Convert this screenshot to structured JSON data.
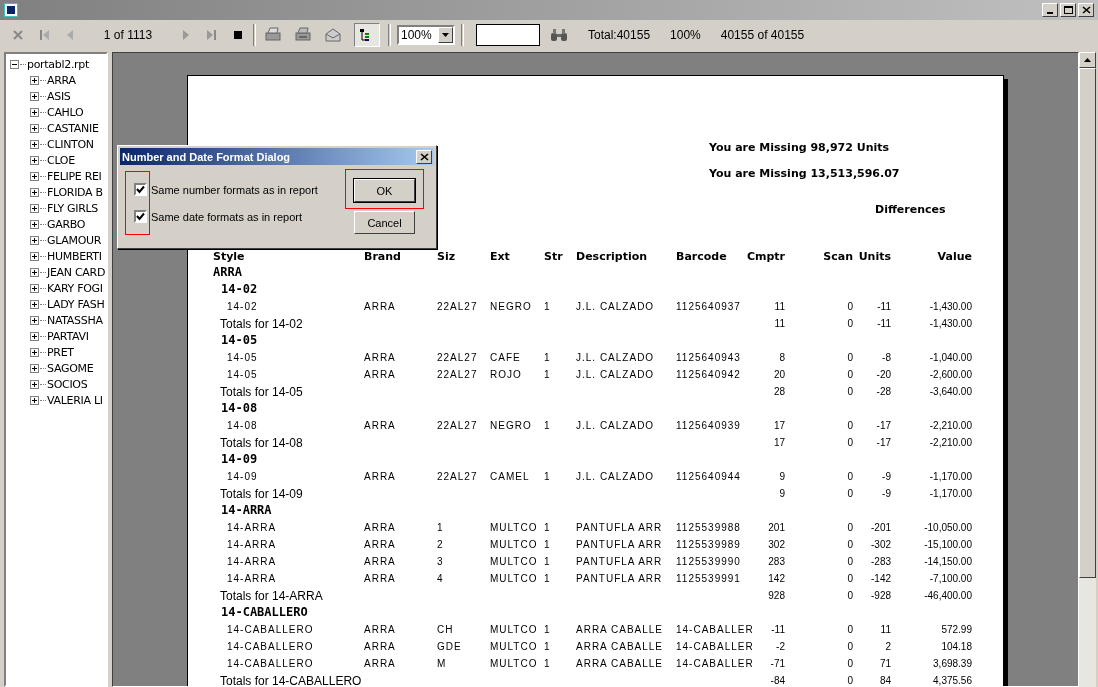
{
  "toolbar": {
    "page_label": "1 of 1113",
    "zoom": "100%",
    "tree_toggle_on": true,
    "total": "Total:40155",
    "percent": "100%",
    "records": "40155 of 40155"
  },
  "tree": {
    "label": "portabl2.rpt",
    "expanded": true,
    "children": [
      {
        "label": "ARRA",
        "expanded": false
      },
      {
        "label": "ASIS",
        "expanded": false
      },
      {
        "label": "CAHLO",
        "expanded": false
      },
      {
        "label": "CASTANIE",
        "expanded": false
      },
      {
        "label": "CLINTON",
        "expanded": false
      },
      {
        "label": "CLOE",
        "expanded": false
      },
      {
        "label": "FELIPE REI",
        "expanded": false
      },
      {
        "label": "FLORIDA B",
        "expanded": false
      },
      {
        "label": "FLY GIRLS",
        "expanded": false
      },
      {
        "label": "GARBO",
        "expanded": false
      },
      {
        "label": "GLAMOUR",
        "expanded": false
      },
      {
        "label": "HUMBERTI",
        "expanded": false
      },
      {
        "label": "JEAN CARD",
        "expanded": false
      },
      {
        "label": "KARY FOGI",
        "expanded": false
      },
      {
        "label": "LADY FASH",
        "expanded": false
      },
      {
        "label": "NATASSHA",
        "expanded": false
      },
      {
        "label": "PARTAVI",
        "expanded": false
      },
      {
        "label": "PRET",
        "expanded": false
      },
      {
        "label": "SAGOME",
        "expanded": false
      },
      {
        "label": "SOCIOS",
        "expanded": false
      },
      {
        "label": "VALERIA LI",
        "expanded": false
      }
    ]
  },
  "report": {
    "summary": [
      "You are Missing 98,972 Units",
      "You are Missing 13,513,596.07"
    ],
    "differences_label": "Differences",
    "columns": [
      "Style",
      "Brand",
      "Siz",
      "Ext",
      "Str",
      "Description",
      "Barcode",
      "Cmptr",
      "Scan",
      "Units",
      "Value"
    ],
    "group": "ARRA",
    "sections": [
      {
        "title": "14-02",
        "rows": [
          [
            "14-02",
            "ARRA",
            "22AL27",
            "NEGRO",
            "1",
            "J.L. CALZADO",
            "1125640937",
            "11",
            "0",
            "-11",
            "-1,430.00"
          ]
        ],
        "totals": {
          "label": "Totals for 14-02",
          "values": [
            "11",
            "0",
            "-11",
            "-1,430.00"
          ]
        }
      },
      {
        "title": "14-05",
        "rows": [
          [
            "14-05",
            "ARRA",
            "22AL27",
            "CAFE",
            "1",
            "J.L. CALZADO",
            "1125640943",
            "8",
            "0",
            "-8",
            "-1,040.00"
          ],
          [
            "14-05",
            "ARRA",
            "22AL27",
            "ROJO",
            "1",
            "J.L. CALZADO",
            "1125640942",
            "20",
            "0",
            "-20",
            "-2,600.00"
          ]
        ],
        "totals": {
          "label": "Totals for 14-05",
          "values": [
            "28",
            "0",
            "-28",
            "-3,640.00"
          ]
        }
      },
      {
        "title": "14-08",
        "rows": [
          [
            "14-08",
            "ARRA",
            "22AL27",
            "NEGRO",
            "1",
            "J.L. CALZADO",
            "1125640939",
            "17",
            "0",
            "-17",
            "-2,210.00"
          ]
        ],
        "totals": {
          "label": "Totals for 14-08",
          "values": [
            "17",
            "0",
            "-17",
            "-2,210.00"
          ]
        }
      },
      {
        "title": "14-09",
        "rows": [
          [
            "14-09",
            "ARRA",
            "22AL27",
            "CAMEL",
            "1",
            "J.L. CALZADO",
            "1125640944",
            "9",
            "0",
            "-9",
            "-1,170.00"
          ]
        ],
        "totals": {
          "label": "Totals for 14-09",
          "values": [
            "9",
            "0",
            "-9",
            "-1,170.00"
          ]
        }
      },
      {
        "title": "14-ARRA",
        "rows": [
          [
            "14-ARRA",
            "ARRA",
            "1",
            "MULTCO",
            "1",
            "PANTUFLA ARR",
            "1125539988",
            "201",
            "0",
            "-201",
            "-10,050.00"
          ],
          [
            "14-ARRA",
            "ARRA",
            "2",
            "MULTCO",
            "1",
            "PANTUFLA ARR",
            "1125539989",
            "302",
            "0",
            "-302",
            "-15,100.00"
          ],
          [
            "14-ARRA",
            "ARRA",
            "3",
            "MULTCO",
            "1",
            "PANTUFLA ARR",
            "1125539990",
            "283",
            "0",
            "-283",
            "-14,150.00"
          ],
          [
            "14-ARRA",
            "ARRA",
            "4",
            "MULTCO",
            "1",
            "PANTUFLA ARR",
            "1125539991",
            "142",
            "0",
            "-142",
            "-7,100.00"
          ]
        ],
        "totals": {
          "label": "Totals for 14-ARRA",
          "values": [
            "928",
            "0",
            "-928",
            "-46,400.00"
          ]
        }
      },
      {
        "title": "14-CABALLERO",
        "rows": [
          [
            "14-CABALLERO",
            "ARRA",
            "CH",
            "MULTCO",
            "1",
            "ARRA CABALLE",
            "14-CABALLER",
            "-11",
            "0",
            "11",
            "572.99"
          ],
          [
            "14-CABALLERO",
            "ARRA",
            "GDE",
            "MULTCO",
            "1",
            "ARRA CABALLE",
            "14-CABALLER",
            "-2",
            "0",
            "2",
            "104.18"
          ],
          [
            "14-CABALLERO",
            "ARRA",
            "M",
            "MULTCO",
            "1",
            "ARRA CABALLE",
            "14-CABALLER",
            "-71",
            "0",
            "71",
            "3,698.39"
          ]
        ],
        "totals": {
          "label": "Totals for 14-CABALLERO",
          "values": [
            "-84",
            "0",
            "84",
            "4,375.56"
          ]
        }
      }
    ]
  },
  "dialog": {
    "title": "Number and Date Format Dialog",
    "options_highlighted": true,
    "options": [
      {
        "label": "Same number formats as in report",
        "checked": true
      },
      {
        "label": "Same date formats as in report",
        "checked": true
      }
    ],
    "buttons": [
      {
        "label": "OK",
        "highlighted": true
      },
      {
        "label": "Cancel",
        "highlighted": false
      }
    ]
  }
}
